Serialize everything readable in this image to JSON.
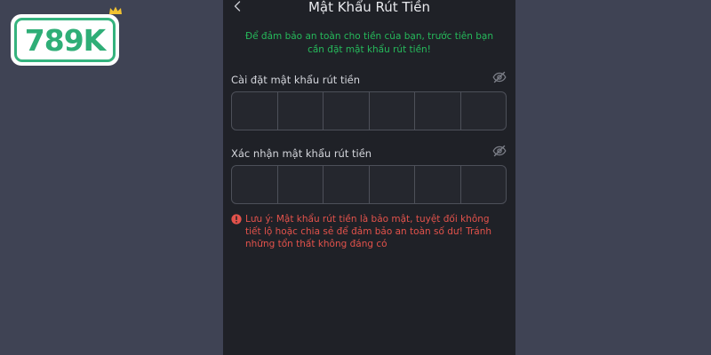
{
  "logo": {
    "text": "789K"
  },
  "header": {
    "title": "Mật Khẩu Rút Tiền",
    "back_icon": "chevron-left-icon"
  },
  "notice": "Để đảm bảo an toàn cho tiền của bạn, trước tiên bạn cần đặt mật khẩu rút tiền!",
  "fields": {
    "set_password": {
      "label": "Cài đặt mật khẩu rút tiền",
      "digits": [
        "",
        "",
        "",
        "",
        "",
        ""
      ],
      "eye_icon": "eye-off-icon"
    },
    "confirm_password": {
      "label": "Xác nhận mật khẩu rút tiền",
      "digits": [
        "",
        "",
        "",
        "",
        "",
        ""
      ],
      "eye_icon": "eye-off-icon"
    }
  },
  "warning": {
    "text": "Lưu ý: Mật khẩu rút tiền là bảo mật, tuyệt đối không tiết lộ hoặc chia sẻ để đảm bảo an toàn số dư! Tránh những tổn thất không đáng có",
    "icon": "alert-circle-icon"
  },
  "colors": {
    "page_bg": "#3f4354",
    "panel_bg": "#1f2127",
    "notice": "#26b95b",
    "warning": "#e2524b",
    "brand": "#2fae77"
  }
}
